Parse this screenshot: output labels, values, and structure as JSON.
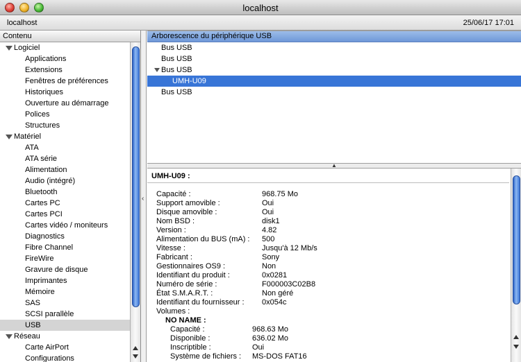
{
  "window": {
    "title": "localhost"
  },
  "infobar": {
    "host": "localhost",
    "datetime": "25/06/17 17:01"
  },
  "sidebar": {
    "header": "Contenu",
    "groups": [
      {
        "label": "Logiciel",
        "items": [
          "Applications",
          "Extensions",
          "Fenêtres de préférences",
          "Historiques",
          "Ouverture au démarrage",
          "Polices",
          "Structures"
        ]
      },
      {
        "label": "Matériel",
        "items": [
          "ATA",
          "ATA série",
          "Alimentation",
          "Audio (intégré)",
          "Bluetooth",
          "Cartes PC",
          "Cartes PCI",
          "Cartes vidéo / moniteurs",
          "Diagnostics",
          "Fibre Channel",
          "FireWire",
          "Gravure de disque",
          "Imprimantes",
          "Mémoire",
          "SAS",
          "SCSI parallèle",
          "USB"
        ]
      },
      {
        "label": "Réseau",
        "items": [
          "Carte AirPort",
          "Configurations"
        ]
      }
    ],
    "selected": "USB"
  },
  "usb_tree": {
    "header": "Arborescence du périphérique USB",
    "rows": [
      {
        "label": "Bus USB",
        "level": 0,
        "expanded": false,
        "selected": false
      },
      {
        "label": "Bus USB",
        "level": 0,
        "expanded": false,
        "selected": false
      },
      {
        "label": "Bus USB",
        "level": 0,
        "expanded": true,
        "selected": false
      },
      {
        "label": "UMH-U09",
        "level": 1,
        "expanded": false,
        "selected": true
      },
      {
        "label": "Bus USB",
        "level": 0,
        "expanded": false,
        "selected": false
      }
    ]
  },
  "details": {
    "heading": "UMH-U09 :",
    "properties": [
      {
        "key": "Capacité :",
        "value": "968.75 Mo"
      },
      {
        "key": "Support amovible :",
        "value": "Oui"
      },
      {
        "key": "Disque amovible :",
        "value": "Oui"
      },
      {
        "key": "Nom BSD :",
        "value": "disk1"
      },
      {
        "key": "Version :",
        "value": "4.82"
      },
      {
        "key": "Alimentation du BUS (mA) :",
        "value": "500"
      },
      {
        "key": "Vitesse :",
        "value": "Jusqu'à 12 Mb/s"
      },
      {
        "key": "Fabricant :",
        "value": "Sony"
      },
      {
        "key": "Gestionnaires OS9 :",
        "value": "Non"
      },
      {
        "key": "Identifiant du produit :",
        "value": "0x0281"
      },
      {
        "key": "Numéro de série :",
        "value": "F000003C02B8"
      },
      {
        "key": "État S.M.A.R.T. :",
        "value": "Non géré"
      },
      {
        "key": "Identifiant du fournisseur :",
        "value": "0x054c"
      },
      {
        "key": "Volumes :",
        "value": ""
      }
    ],
    "volume": {
      "name": "NO NAME :",
      "properties": [
        {
          "key": "Capacité :",
          "value": "968.63 Mo"
        },
        {
          "key": "Disponible :",
          "value": "636.02 Mo"
        },
        {
          "key": "Inscriptible :",
          "value": "Oui"
        },
        {
          "key": "Système de fichiers :",
          "value": "MS-DOS FAT16"
        }
      ]
    }
  }
}
